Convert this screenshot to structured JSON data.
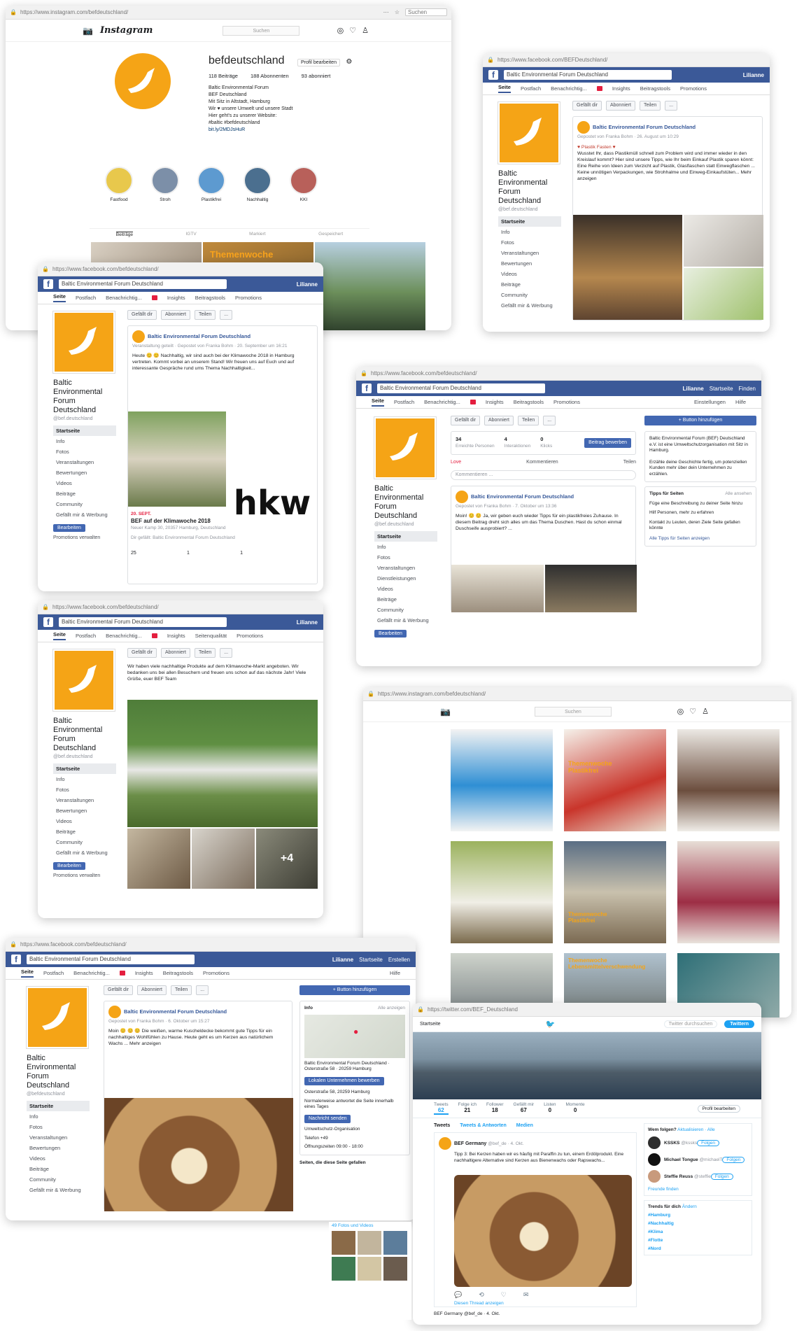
{
  "colors": {
    "brand_orange": "#f5a416",
    "facebook_blue": "#3b5998",
    "twitter_blue": "#1da1f2",
    "bg": "#ffffff"
  },
  "instagram_profile": {
    "url": "https://www.instagram.com/befdeutschland/",
    "search_placeholder": "Suchen",
    "logo_text": "Instagram",
    "search": "Suchen",
    "username": "befdeutschland",
    "edit_button": "Profil bearbeiten",
    "stats": [
      "118 Beiträge",
      "188 Abonnenten",
      "93 abonniert"
    ],
    "bio": [
      "Baltic Environmental Forum",
      "BEF Deutschland",
      "Mit Sitz in Altstadt, Hamburg",
      "Wir ♥ unsere Umwelt und unsere Stadt",
      "Hier geht's zu unserer Website:",
      "#baltic #befdeutschland",
      "bit.ly/2MDJsHuR"
    ],
    "highlights": [
      "Fastfood",
      "Stroh",
      "Plastikfrei",
      "Nachhaltig",
      "KKI"
    ],
    "tabs": [
      "Beiträge",
      "IGTV",
      "Markiert",
      "Gespeichert"
    ],
    "post_caption": "Themenwoche"
  },
  "fb_shot1": {
    "url": "https://www.facebook.com/BEFDeutschland/",
    "search": "Baltic Environmental Forum Deutschland",
    "user": "Lilianne",
    "tabs": [
      "Seite",
      "Postfach",
      "Benachrichtig...",
      "Insights",
      "Beitragstools",
      "Promotions"
    ],
    "page_name": "Baltic Environmental Forum Deutschland",
    "handle": "@bef.deutschland",
    "nav": [
      "Startseite",
      "Info",
      "Fotos",
      "Veranstaltungen",
      "Bewertungen",
      "Videos",
      "Beiträge",
      "Community",
      "Gefällt mir & Werbung"
    ],
    "actions": [
      "Gefällt dir",
      "Abonniert",
      "Teilen",
      "..."
    ],
    "post_author": "Baltic Environmental Forum Deutschland",
    "post_meta": "Gepostet von Franka Bohm · 26. August um 10:29",
    "post_text": [
      "♥ Plastik Fasten ♥",
      "Wusstet Ihr, dass Plastikmüll schnell zum Problem wird und immer wieder in den Kreislauf kommt? Hier sind unsere Tipps, wie Ihr beim Einkauf Plastik sparen könnt:",
      "Eine Reihe von Ideen zum Verzicht auf Plastik, Glasflaschen statt Einwegflaschen ...",
      "Keine unnötigen Verpackungen, wie Strohhalme und Einweg-Einkaufstüten... Mehr anzeigen"
    ]
  },
  "fb_shot2": {
    "url": "https://www.facebook.com/befdeutschland/",
    "search": "Baltic Environmental Forum Deutschland",
    "user": "Lilianne",
    "tabs": [
      "Seite",
      "Postfach",
      "Benachrichtig...",
      "Insights",
      "Beitragstools",
      "Promotions"
    ],
    "page_name": "Baltic Environmental Forum Deutschland",
    "handle": "@bef.deutschland",
    "nav": [
      "Startseite",
      "Info",
      "Fotos",
      "Veranstaltungen",
      "Bewertungen",
      "Videos",
      "Beiträge",
      "Community",
      "Gefällt mir & Werbung"
    ],
    "btn1": "Bearbeiten",
    "btn2": "Promotions verwalten",
    "actions": [
      "Gefällt dir",
      "Abonniert",
      "Teilen",
      "..."
    ],
    "post_author": "Baltic Environmental Forum Deutschland",
    "post_meta": "Veranstaltung geteilt · Gepostet von Franka Bohm · 20. September um 16:21",
    "post_text": "Heute 😊 😊 Nachhaltig, wir sind auch bei der Klimawoche 2018 in Hamburg vertreten. Kommt vorbei an unserem Stand! Wir freuen uns auf Euch und auf interessante Gespräche rund ums Thema Nachhaltigkeit...",
    "event_date": "20. SEPT.",
    "event_title": "BEF auf der Klimawoche 2018",
    "event_meta": "Neuer Kamp 30, 20357 Hamburg, Deutschland",
    "likes_line": "Dir gefällt: Baltic Environmental Forum Deutschland",
    "counts": [
      "25",
      "1",
      "1"
    ],
    "logo_text": "hkw"
  },
  "fb_shot3": {
    "url": "https://www.facebook.com/befdeutschland/",
    "search": "Baltic Environmental Forum Deutschland",
    "right_nav": [
      "Lilianne",
      "Startseite",
      "Finden"
    ],
    "tabs": [
      "Seite",
      "Postfach",
      "Benachrichtig...",
      "Insights",
      "Beitragstools",
      "Promotions"
    ],
    "settings": "Einstellungen",
    "help": "Hilfe",
    "page_name": "Baltic Environmental Forum Deutschland",
    "handle": "@bef.deutschland",
    "nav": [
      "Startseite",
      "Info",
      "Fotos",
      "Veranstaltungen",
      "Dienstleistungen",
      "Videos",
      "Beiträge",
      "Community",
      "Gefällt mir & Werbung"
    ],
    "btn1": "Bearbeiten",
    "actions": [
      "Gefällt dir",
      "Abonniert",
      "Teilen",
      "..."
    ],
    "add_button": "+ Button hinzufügen",
    "stats": [
      {
        "value": "34",
        "label": "Erreichte Personen"
      },
      {
        "value": "4",
        "label": "Interaktionen"
      },
      {
        "value": "0",
        "label": "Klicks"
      }
    ],
    "boost": "Beitrag bewerben",
    "reactions": [
      "Love",
      "Kommentieren",
      "Teilen"
    ],
    "comment_placeholder": "Kommentieren ...",
    "post_author": "Baltic Environmental Forum Deutschland",
    "post_meta": "Gepostet von Franka Bohm · 7. Oktober um 13:36",
    "post_text": "Moin! 😊 😊 Ja, wir geben euch wieder Tipps für ein plastikfreies Zuhause. In diesem Beitrag dreht sich alles um das Thema Duschen. Hast du schon einmal Duschseife ausprobiert? ...",
    "about_title": "Baltic Environmental Forum (BEF) Deutschland e.V. ist eine Umweltschutzorganisation mit Sitz in Hamburg.",
    "about_more": "Erzähle deine Geschichte fertig, um potenziellen Kunden mehr über dein Unternehmen zu erzählen.",
    "tips_title": "Tipps für Seiten",
    "tips_all": "Alle ansehen",
    "tips": [
      "Füge eine Beschreibung zu deiner Seite hinzu",
      "Hilf Personen, mehr zu erfahren",
      "Kontakt zu Leuten, deren Ziele Seite gefallen könnte"
    ],
    "more_link": "Alle Tipps für Seiten anzeigen"
  },
  "fb_shot4": {
    "url": "https://www.facebook.com/befdeutschland/",
    "search": "Baltic Environmental Forum Deutschland",
    "user": "Lilianne",
    "tabs": [
      "Seite",
      "Postfach",
      "Benachrichtig...",
      "Insights",
      "Seitenqualität",
      "Promotions"
    ],
    "page_name": "Baltic Environmental Forum Deutschland",
    "handle": "@bef.deutschland",
    "nav": [
      "Startseite",
      "Info",
      "Fotos",
      "Veranstaltungen",
      "Bewertungen",
      "Videos",
      "Beiträge",
      "Community",
      "Gefällt mir & Werbung"
    ],
    "btn1": "Bearbeiten",
    "btn2": "Promotions verwalten",
    "actions": [
      "Gefällt dir",
      "Abonniert",
      "Teilen",
      "..."
    ],
    "post_text": "Wir haben viele nachhaltige Produkte auf dem Klimawoche-Markt angeboten. Wir bedanken uns bei allen Besuchern und freuen uns schon auf das nächste Jahr! Viele Grüße, euer BEF Team",
    "more_count": "+4"
  },
  "fb_shot5": {
    "url": "https://www.facebook.com/befdeutschland/",
    "search": "Baltic Environmental Forum Deutschland",
    "right_nav": [
      "Lilianne",
      "Startseite",
      "Erstellen"
    ],
    "tabs": [
      "Seite",
      "Postfach",
      "Benachrichtig...",
      "Insights",
      "Beitragstools",
      "Promotions"
    ],
    "help": "Hilfe",
    "page_name": "Baltic Environmental Forum Deutschland",
    "handle": "@befdeutschland",
    "nav": [
      "Startseite",
      "Info",
      "Fotos",
      "Veranstaltungen",
      "Bewertungen",
      "Videos",
      "Beiträge",
      "Community",
      "Gefällt mir & Werbung"
    ],
    "actions": [
      "Gefällt dir",
      "Abonniert",
      "Teilen",
      "..."
    ],
    "add_button": "+ Button hinzufügen",
    "post_author": "Baltic Environmental Forum Deutschland",
    "post_meta": "Gepostet von Franka Bohm · 6. Oktober um 15:27",
    "post_text": "Moin 😊 😊 😊 Die weißen, warme Kuscheldecke bekommt gute Tipps für ein nachhaltiges Wohlfühlen zu Hause. Heute geht es um Kerzen aus natürlichem Wachs ... Mehr anzeigen",
    "info_title": "Info",
    "info_link": "Alle anzeigen",
    "map_caption": "Baltic Environmental Forum Deutschland · Osterstraße 58 · 20259 Hamburg",
    "map_button": "Lokalen Unternehmen bewerben",
    "info_lines": [
      "Osterstraße 58, 20259 Hamburg",
      "Normalerweise antwortet die Seite innerhalb eines Tages",
      "Nachricht senden",
      "Umweltschutz-Organisation",
      "Telefon +49",
      "Öffnungszeiten 09:00 - 18:00"
    ],
    "footer": "Seiten, die diese Seite gefallen"
  },
  "instagram_grid": {
    "url": "https://www.instagram.com/befdeutschland/",
    "search": "Suchen",
    "captions": [
      "",
      "Themenwoche Plastikfrei",
      "",
      "",
      "Themenwoche Plastikfrei",
      "",
      "",
      "Themenwoche Lebensmittelverschwendung",
      ""
    ]
  },
  "twitter": {
    "url": "https://twitter.com/BEF_Deutschland",
    "top_left": "Startseite",
    "search": "Twitter durchsuchen",
    "tweet_button": "Twittern",
    "stats": [
      {
        "label": "Tweets",
        "value": "62"
      },
      {
        "label": "Folge ich",
        "value": "21"
      },
      {
        "label": "Follower",
        "value": "18"
      },
      {
        "label": "Gefällt mir",
        "value": "67"
      },
      {
        "label": "Listen",
        "value": "0"
      },
      {
        "label": "Momente",
        "value": "0"
      }
    ],
    "edit_profile": "Profil bearbeiten",
    "tabs": [
      "Tweets",
      "Tweets & Antworten",
      "Medien"
    ],
    "tweet_author": "BEF Germany",
    "tweet_handle": "@bef_de · 4. Okt.",
    "tweet_text": "Tipp 3: Bei Kerzen haben wir es häufig mit Paraffin zu tun, einem Erdölprodukt. Eine nachhaltigere Alternative sind Kerzen aus Bienenwachs oder Rapswachs...",
    "show_thread": "Diesen Thread anzeigen",
    "who_to_follow_title": "Wem folgen?",
    "who_to_follow_links": "Aktualisieren · Alle",
    "suggestions": [
      {
        "name": "KSSKS",
        "handle": "@kssks"
      },
      {
        "name": "Michael Tongue",
        "handle": "@michaelT"
      },
      {
        "name": "Steffie Reuss",
        "handle": "@steffie"
      }
    ],
    "follow": "Folgen",
    "find_people": "Freunde finden",
    "trends_title": "Trends für dich",
    "trends_change": "Ändern",
    "trends": [
      "#Hamburg",
      "#Nachhaltig",
      "#Klima",
      "#Flotte",
      "#Nord"
    ],
    "media_title": "49 Fotos und Videos",
    "next_tweet": "BEF Germany @bef_de · 4. Okt."
  }
}
